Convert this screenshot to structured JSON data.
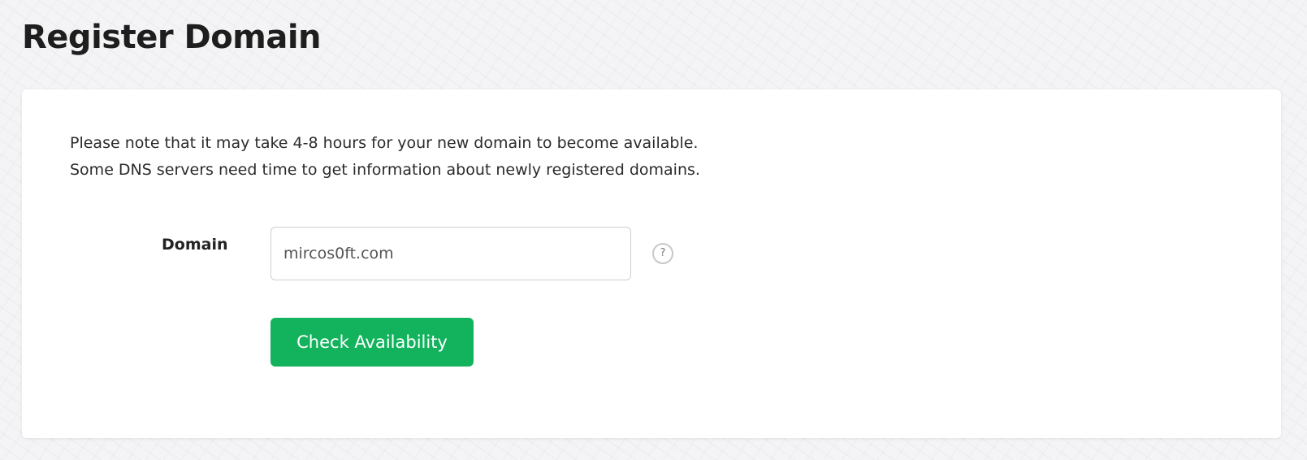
{
  "page": {
    "title": "Register Domain"
  },
  "notice": {
    "line1": "Please note that it may take 4-8 hours for your new domain to become available.",
    "line2": "Some DNS servers need time to get information about newly registered domains."
  },
  "form": {
    "domain_label": "Domain",
    "domain_value": "mircos0ft.com",
    "help_glyph": "?",
    "help_icon": "question-circle-icon",
    "submit_label": "Check Availability"
  },
  "colors": {
    "button": "#13b35e",
    "background": "#f4f4f6",
    "card": "#ffffff"
  }
}
